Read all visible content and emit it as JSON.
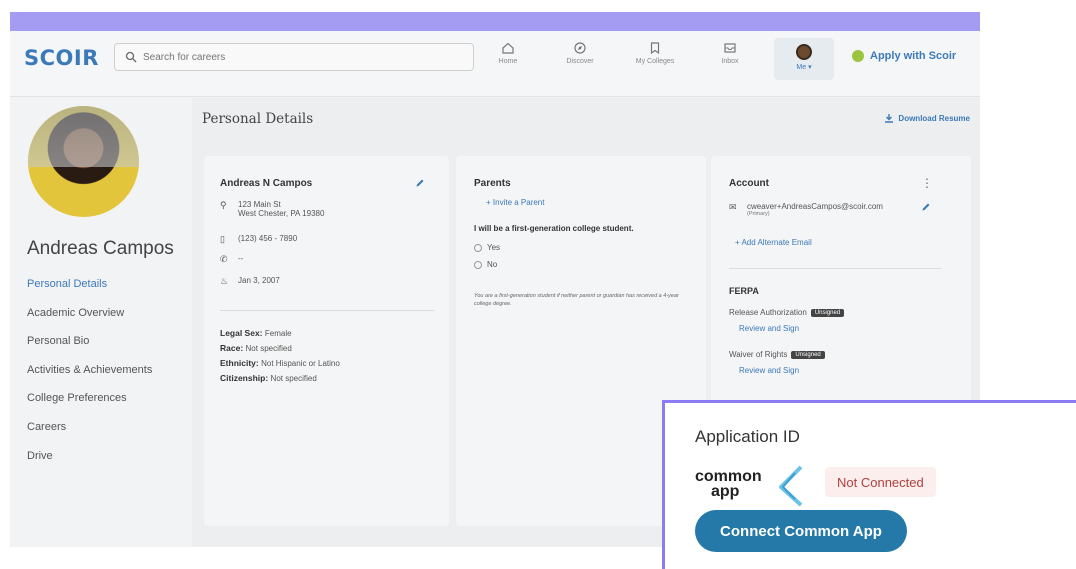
{
  "app": {
    "logo": "SCOIR"
  },
  "search": {
    "placeholder": "Search for careers"
  },
  "nav": {
    "items": [
      {
        "label": "Home",
        "icon": "home-icon"
      },
      {
        "label": "Discover",
        "icon": "compass-icon"
      },
      {
        "label": "My Colleges",
        "icon": "bookmark-icon"
      },
      {
        "label": "Inbox",
        "icon": "inbox-icon"
      }
    ],
    "me_label": "Me ▾",
    "apply_label": "Apply with Scoir"
  },
  "sidebar": {
    "name": "Andreas Campos",
    "items": [
      {
        "label": "Personal Details",
        "active": true
      },
      {
        "label": "Academic Overview"
      },
      {
        "label": "Personal Bio"
      },
      {
        "label": "Activities & Achievements"
      },
      {
        "label": "College Preferences"
      },
      {
        "label": "Careers"
      },
      {
        "label": "Drive"
      }
    ]
  },
  "main": {
    "title": "Personal Details",
    "download": "Download Resume"
  },
  "card1": {
    "name": "Andreas N Campos",
    "address1": "123 Main St",
    "address2": "West Chester, PA 19380",
    "phone": "(123) 456 - 7890",
    "other_phone": "--",
    "dob": "Jan 3, 2007",
    "legal_sex_label": "Legal Sex:",
    "legal_sex": "Female",
    "race_label": "Race:",
    "race": "Not specified",
    "ethnicity_label": "Ethnicity:",
    "ethnicity": "Not Hispanic or Latino",
    "citizenship_label": "Citizenship:",
    "citizenship": "Not specified"
  },
  "card2": {
    "title": "Parents",
    "invite": "+ Invite a Parent",
    "question": "I will be a first-generation college student.",
    "yes": "Yes",
    "no": "No",
    "note": "You are a first-generation student if neither parent or guardian has received a 4-year college degree."
  },
  "card3": {
    "title": "Account",
    "email": "cweaver+AndreasCampos@scoir.com",
    "primary": "(Primary)",
    "add_email": "+ Add Alternate Email",
    "ferpa_title": "FERPA",
    "release": "Release Authorization",
    "release_badge": "Unsigned",
    "release_link": "Review and Sign",
    "waiver": "Waiver of Rights",
    "waiver_badge": "Unsigned",
    "waiver_link": "Review and Sign"
  },
  "overlay": {
    "title": "Application ID",
    "logo_line1": "common",
    "logo_line2": "app",
    "status": "Not Connected",
    "button": "Connect Common App"
  },
  "colors": {
    "accent": "#3c79b9",
    "purple": "#8b7cf6",
    "button": "#2479a8",
    "error": "#b0413e"
  }
}
